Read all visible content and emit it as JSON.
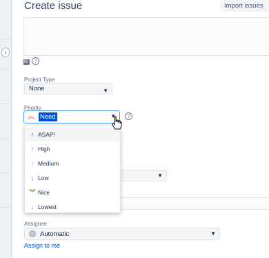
{
  "dialog": {
    "title": "Create issue",
    "import_label": "Import issues"
  },
  "description": {
    "markup_icon": "markdown-icon",
    "help_icon": "help-icon",
    "help_glyph": "?"
  },
  "project_type": {
    "label": "Project Type",
    "value": "None"
  },
  "priority": {
    "label": "Priority",
    "value": "Need",
    "icon": "double-chevron-up-icon",
    "help_glyph": "?",
    "options": [
      {
        "label": "ASAP!",
        "icon": "arrow-up-icon",
        "color": "#cd1316"
      },
      {
        "label": "High",
        "icon": "arrow-up-icon",
        "color": "#e9494a"
      },
      {
        "label": "Medium",
        "icon": "arrow-up-icon",
        "color": "#e97f33"
      },
      {
        "label": "Low",
        "icon": "arrow-down-icon",
        "color": "#2a8735"
      },
      {
        "label": "Nice",
        "icon": "double-chevron-down-icon",
        "color": "#55a63a"
      },
      {
        "label": "Lowest",
        "icon": "arrow-down-icon",
        "color": "#55a63a"
      }
    ],
    "selected_option": "ASAP!"
  },
  "assignee": {
    "label": "Assignee",
    "value": "Automatic",
    "link": "Assign to me"
  },
  "colors": {
    "accent": "#0052cc",
    "focus_border": "#4c9aff",
    "field_bg": "#f4f5f7"
  }
}
